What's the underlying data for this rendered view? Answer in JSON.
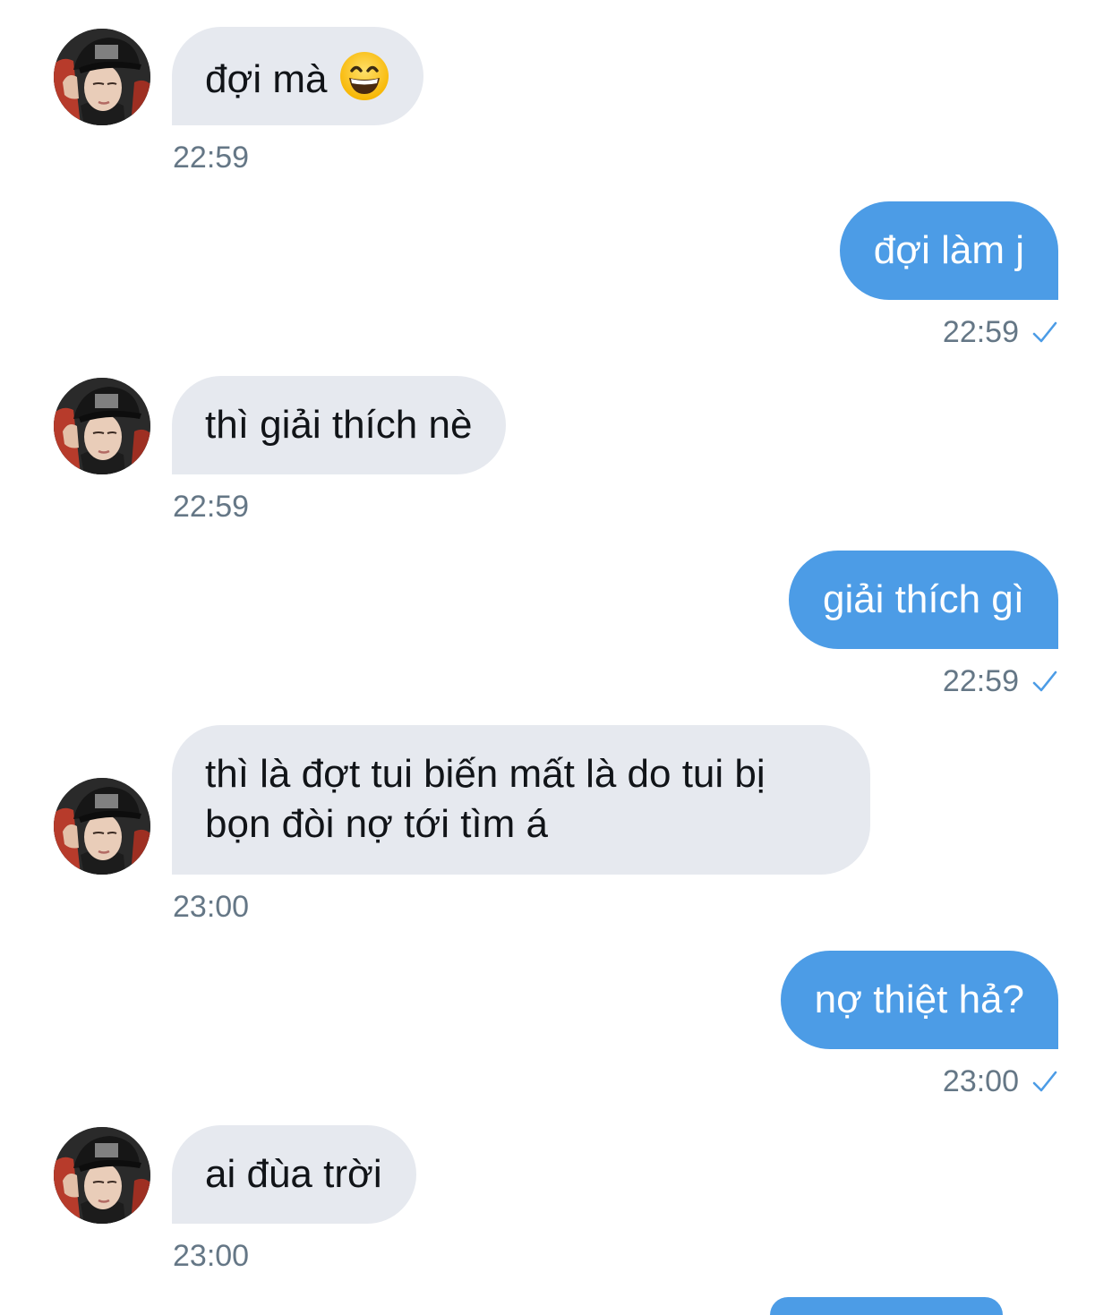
{
  "messages": [
    {
      "side": "in",
      "text": "đợi mà",
      "emoji": "grinning-face-emoji",
      "time": "22:59"
    },
    {
      "side": "out",
      "text": "đợi làm j",
      "time": "22:59",
      "status": "sent-checkmark"
    },
    {
      "side": "in",
      "text": "thì giải thích nè",
      "time": "22:59"
    },
    {
      "side": "out",
      "text": "giải thích gì",
      "time": "22:59",
      "status": "sent-checkmark"
    },
    {
      "side": "in",
      "text_lines": [
        "thì là đợt tui biến mất là do tui bị",
        "bọn đòi nợ tới tìm á"
      ],
      "time": "23:00"
    },
    {
      "side": "out",
      "text": "nợ thiệt hả?",
      "time": "23:00",
      "status": "sent-checkmark"
    },
    {
      "side": "in",
      "text": "ai đùa trời",
      "time": "23:00"
    }
  ],
  "colors": {
    "incoming_bubble": "#e6e9ef",
    "outgoing_bubble": "#4c9ce6",
    "timestamp": "#657786",
    "checkmark": "#4c9ce6"
  }
}
